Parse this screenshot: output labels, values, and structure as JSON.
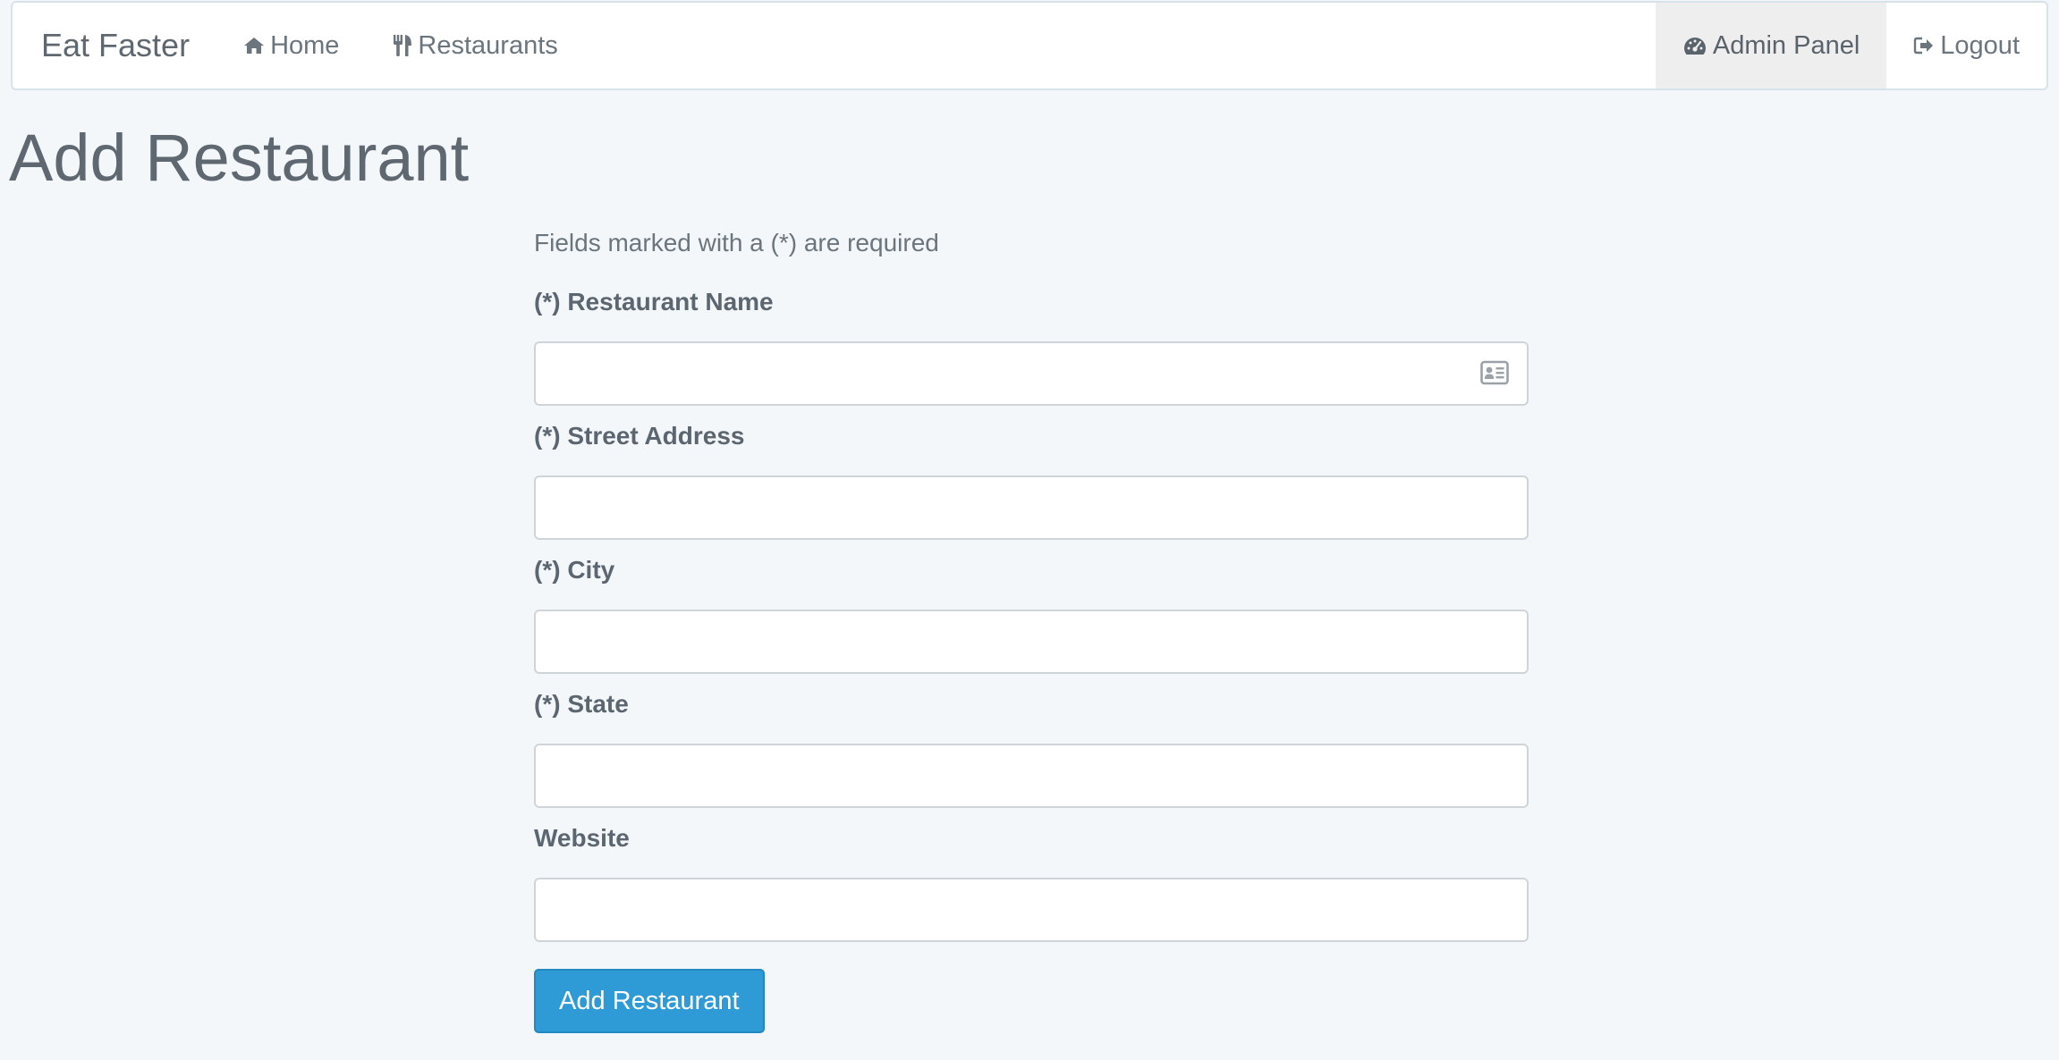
{
  "nav": {
    "brand": "Eat Faster",
    "home_label": "Home",
    "home_icon": "home-icon",
    "restaurants_label": "Restaurants",
    "restaurants_icon": "cutlery-icon",
    "admin_label": "Admin Panel",
    "admin_icon": "dashboard-icon",
    "logout_label": "Logout",
    "logout_icon": "logout-icon"
  },
  "page": {
    "title": "Add Restaurant"
  },
  "form": {
    "note": "Fields marked with a (*) are required",
    "fields": [
      {
        "label": "(*) Restaurant Name",
        "value": "",
        "placeholder": "",
        "icon": "contact-card-icon"
      },
      {
        "label": "(*) Street Address",
        "value": "",
        "placeholder": ""
      },
      {
        "label": "(*) City",
        "value": "",
        "placeholder": ""
      },
      {
        "label": "(*) State",
        "value": "",
        "placeholder": ""
      },
      {
        "label": "Website",
        "value": "",
        "placeholder": ""
      }
    ],
    "submit_label": "Add Restaurant"
  },
  "colors": {
    "background": "#f3f7fa",
    "primary_button": "#2e9bd6",
    "active_nav": "#eeeeee"
  }
}
